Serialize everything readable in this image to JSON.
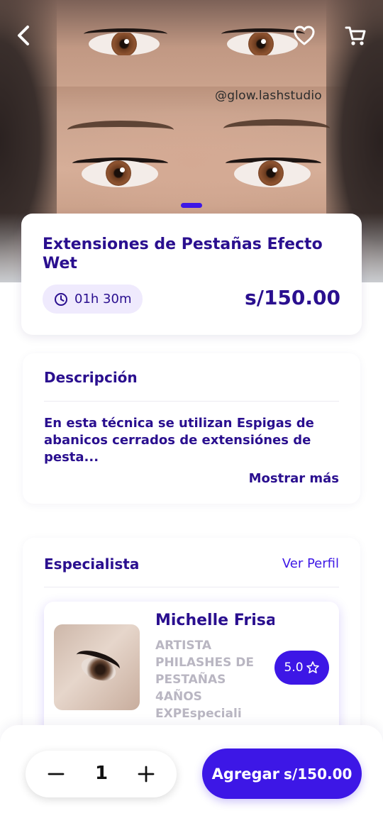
{
  "hero": {
    "watermark": "@glow.lashstudio",
    "page_indicator": {
      "current": 1
    },
    "icons": {
      "back": "chevron-left-icon",
      "favorite": "heart-outline-icon",
      "cart": "cart-icon"
    }
  },
  "service": {
    "title": "Extensiones de Pestañas Efecto Wet",
    "duration": "01h 30m",
    "duration_icon": "clock-icon",
    "price": "s/150.00"
  },
  "description": {
    "heading": "Descripción",
    "text": "En esta técnica se utilizan Espigas de abanicos cerrados de extensiónes de pesta...",
    "more_label": "Mostrar más"
  },
  "specialist": {
    "heading": "Especialista",
    "profile_link": "Ver Perfil",
    "name": "Michelle Frisa",
    "role": "ARTISTA PHILASHES DE PESTAÑAS 4AÑOS EXPEspeciali",
    "rating": "5.0",
    "rating_icon": "star-outline-icon"
  },
  "cart_bar": {
    "quantity": "1",
    "add_label": "Agregar",
    "add_price": "s/150.00"
  },
  "colors": {
    "primary": "#3d17e6",
    "text_primary": "#2a0f8f",
    "muted": "#b9b6c2",
    "pill_bg": "#efeafd"
  }
}
